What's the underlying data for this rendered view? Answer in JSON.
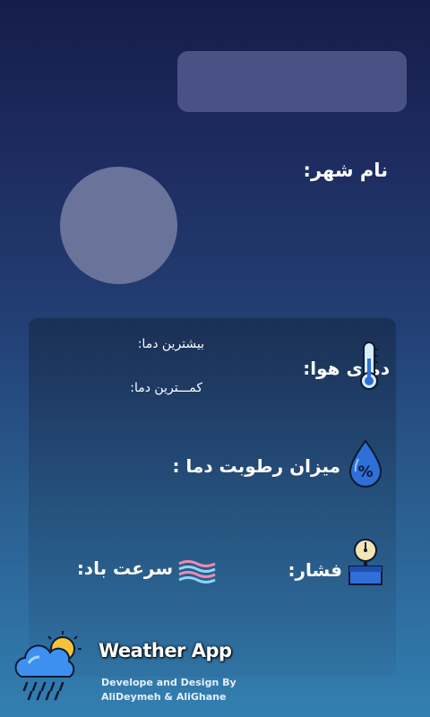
{
  "search": {
    "value": ""
  },
  "city": {
    "label": "نام شهر:"
  },
  "weather": {
    "icon": "weather-condition-icon"
  },
  "card": {
    "temperature_label": "دمای هوا:",
    "max_temp_label": "بیشترین دما:",
    "min_temp_label": "کمـــترین دما:",
    "humidity_label": "میزان رطوبت دما :",
    "pressure_label": "فشار:",
    "wind_label": "سرعت باد:"
  },
  "footer": {
    "app_name": "Weather App",
    "credit_line1": "Develope and Design By",
    "credit_line2": "AliDeymeh & AliGhane"
  },
  "icons": [
    "thermometer-icon",
    "humidity-drop-icon",
    "pressure-gauge-icon",
    "wind-icon",
    "cloud-sun-rain-icon"
  ],
  "colors": {
    "accent_blue": "#2f6fd8",
    "panel": "#4a5184"
  }
}
